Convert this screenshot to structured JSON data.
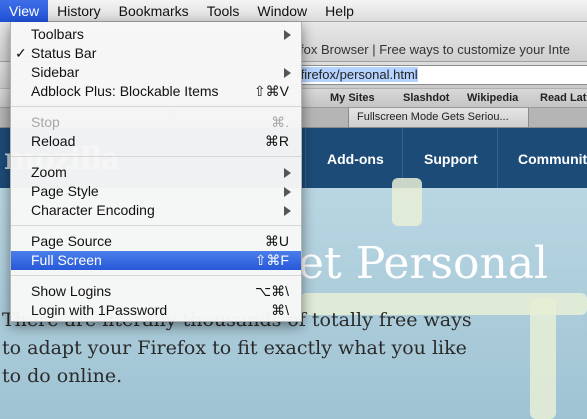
{
  "menubar": {
    "items": [
      "View",
      "History",
      "Bookmarks",
      "Tools",
      "Window",
      "Help"
    ],
    "active": "View"
  },
  "browser": {
    "title_fragment": "fox Browser | Free ways to customize your Inte",
    "url_prefix": "/",
    "url": "firefox/personal.html",
    "bookmarks": [
      "My Sites",
      "Slashdot",
      "Wikipedia",
      "Read Lat"
    ],
    "tabs": [
      "Fullscreen Mode Gets Seriou..."
    ]
  },
  "site": {
    "logo": "mozilla",
    "nav": [
      "Add-ons",
      "Support",
      "Communit"
    ],
    "hero": "et Personal",
    "intro": "There are literally thousands of totally free ways to adapt your Firefox to fit exactly what you like to do online."
  },
  "menu": {
    "toolbars": "Toolbars",
    "status_bar": "Status Bar",
    "sidebar": "Sidebar",
    "adblock": "Adblock Plus: Blockable Items",
    "adblock_shortcut": "⇧⌘V",
    "stop": "Stop",
    "stop_shortcut": "⌘.",
    "reload": "Reload",
    "reload_shortcut": "⌘R",
    "zoom": "Zoom",
    "page_style": "Page Style",
    "char_encoding": "Character Encoding",
    "page_source": "Page Source",
    "page_source_shortcut": "⌘U",
    "full_screen": "Full Screen",
    "full_screen_shortcut": "⇧⌘F",
    "show_logins": "Show Logins",
    "show_logins_shortcut": "⌥⌘\\",
    "login_1password": "Login with 1Password",
    "login_1password_shortcut": "⌘\\",
    "checkmark": "✓"
  }
}
